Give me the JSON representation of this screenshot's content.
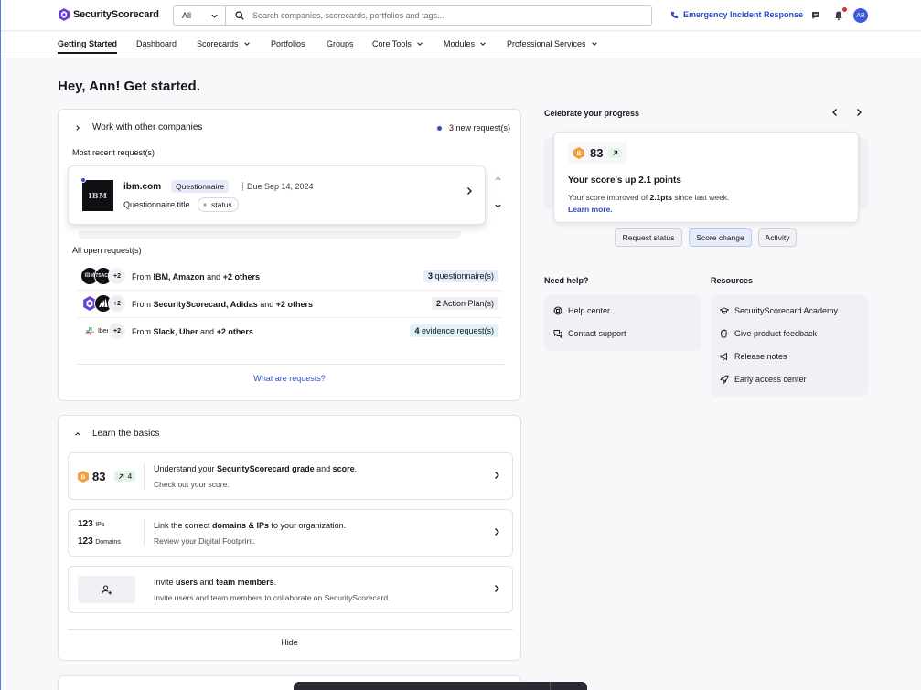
{
  "header": {
    "logo_text": "SecurityScorecard",
    "scope_value": "All",
    "search_placeholder": "Search companies, scorecards, portfolios and tags...",
    "emergency_label": "Emergency Incident Response",
    "avatar_initials": "AB"
  },
  "nav": {
    "items": [
      {
        "label": "Getting Started",
        "active": true
      },
      {
        "label": "Dashboard"
      },
      {
        "label": "Scorecards",
        "dropdown": true
      },
      {
        "label": "Portfolios"
      },
      {
        "label": "Groups"
      },
      {
        "label": "Core Tools",
        "dropdown": true
      },
      {
        "label": "Modules",
        "dropdown": true
      },
      {
        "label": "Professional Services",
        "dropdown": true
      }
    ]
  },
  "greeting": "Hey, Ann! Get started.",
  "work": {
    "title": "Work with other companies",
    "new_requests": "3 new request(s)",
    "recent_label": "Most recent request(s)",
    "recent": {
      "logo_text": "IBM",
      "domain": "ibm.com",
      "type": "Questionnaire",
      "due": "Due Sep 14, 2024",
      "title": "Questionnaire title",
      "status": "status"
    },
    "open_label": "All open request(s)",
    "open_rows": [
      {
        "logo_a": "IBM",
        "logo_b": "TSACH",
        "more": "+2",
        "prefix": "From ",
        "names": "IBM, Amazon",
        "mid": " and ",
        "others": "+2 others",
        "badge_num": "3",
        "badge_text": " questionnaire(s)",
        "badge_color": "#e7ecfb"
      },
      {
        "logo_a": "",
        "logo_b": "",
        "more": "+2",
        "prefix": "From ",
        "names": "SecurityScorecard, Adidas",
        "mid": " and ",
        "others": "+2 others",
        "badge_num": "2",
        "badge_text": " Action Plan(s)",
        "badge_color": "#efeff3"
      },
      {
        "logo_a": "",
        "logo_b": "Iber",
        "more": "+2",
        "prefix": "From ",
        "names": "Slack, Uber",
        "mid": " and ",
        "others": "+2 others",
        "badge_num": "4",
        "badge_text": " evidence request(s)",
        "badge_color": "#dff3f6"
      }
    ],
    "what_link": "What are requests?"
  },
  "learn": {
    "title": "Learn the basics",
    "score": {
      "grade": "B",
      "value": "83",
      "trend": "4",
      "title_parts": [
        "Understand your ",
        "SecurityScorecard grade",
        " and ",
        "score",
        "."
      ],
      "subtitle": "Check out your score."
    },
    "footprint": {
      "ips_count": "123",
      "ips_label": "IPs",
      "domains_count": "123",
      "domains_label": "Domains",
      "title_parts": [
        "Link the correct ",
        "domains & IPs",
        " to your organization."
      ],
      "subtitle": "Review your Digital Footprint."
    },
    "invite": {
      "title_parts": [
        "Invite ",
        "users",
        " and ",
        "team members",
        "."
      ],
      "subtitle": "Invite users and team members to collaborate on SecurityScorecard."
    },
    "hide_label": "Hide"
  },
  "progress": {
    "title": "Celebrate your progress",
    "grade": "B",
    "score": "83",
    "headline": "Your score's up 2.1 points",
    "sub_prefix": "Your score improved of ",
    "sub_value": "2.1pts",
    "sub_suffix": " since last week.",
    "learn_more": "Learn more.",
    "tabs": [
      "Request status",
      "Score change",
      "Activity"
    ],
    "active_tab": "Score change"
  },
  "help": {
    "title": "Need help?",
    "items": [
      "Help center",
      "Contact support"
    ]
  },
  "resources": {
    "title": "Resources",
    "items": [
      "SecurityScorecard Academy",
      "Give product feedback",
      "Release notes",
      "Early access center"
    ]
  },
  "colors": {
    "accent": "#2d4bc6",
    "grade_b": "#f59f3a",
    "trend_bg": "#e3f5e6"
  }
}
